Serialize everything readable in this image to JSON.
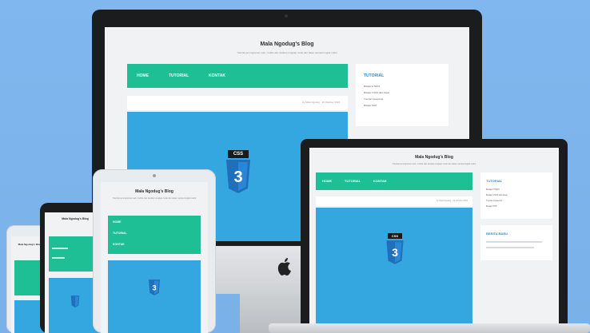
{
  "blog": {
    "title": "Mala Ngodug's Blog",
    "subtitle": "Tutorial pemrograman web, mobile dan desktop lengkap mulai dari dasar sampai tingkat mahir"
  },
  "nav": [
    "HOME",
    "TUTORIAL",
    "KONTAK"
  ],
  "sidebar": {
    "heading": "TUTORIAL",
    "lines": [
      "Belajar HTML5",
      "Belajar CSS3 dari dasar",
      "Tutorial Javascript",
      "Belajar PHP"
    ],
    "heading2": "BERITA BARU"
  },
  "post_meta": "by Mala Ngodug · 20 Oktober 2016",
  "hero": {
    "badge_text": "CSS",
    "shield_number": "3"
  },
  "colors": {
    "background": "#7fb5ec",
    "nav": "#1fbf96",
    "hero": "#35a7e0",
    "bezel": "#1b1c1e"
  },
  "icons": [
    "apple-logo-icon",
    "css3-shield-icon"
  ]
}
